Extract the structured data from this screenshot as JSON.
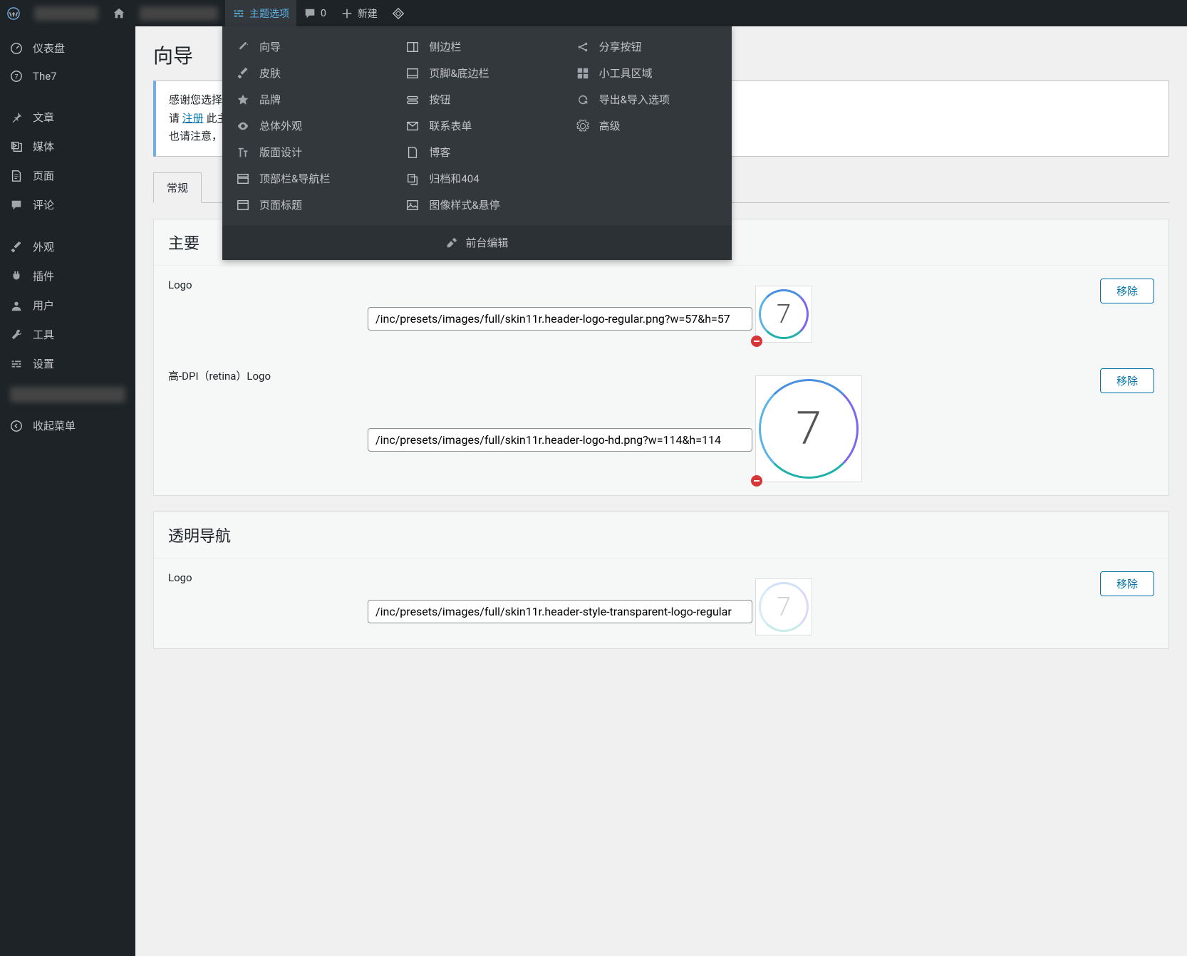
{
  "topbar": {
    "theme_options": "主题选项",
    "comments_count": "0",
    "new": "新建"
  },
  "sidebar": {
    "dashboard": "仪表盘",
    "the7": "The7",
    "posts": "文章",
    "media": "媒体",
    "pages": "页面",
    "comments": "评论",
    "appearance": "外观",
    "plugins": "插件",
    "users": "用户",
    "tools": "工具",
    "settings": "设置",
    "collapse": "收起菜单"
  },
  "dropdown": {
    "col1": {
      "wizard": "向导",
      "skin": "皮肤",
      "brand": "品牌",
      "general": "总体外观",
      "layout": "版面设计",
      "topbar_nav": "顶部栏&导航栏",
      "page_title": "页面标题"
    },
    "col2": {
      "sidebar": "侧边栏",
      "footer": "页脚&底边栏",
      "button": "按钮",
      "contact_form": "联系表单",
      "blog": "博客",
      "archive": "归档和404",
      "image_hover": "图像样式&悬停"
    },
    "col3": {
      "share": "分享按钮",
      "widget": "小工具区域",
      "import_export": "导出&导入选项",
      "advanced": "高级"
    },
    "footer": "前台编辑"
  },
  "page": {
    "title": "向导",
    "notice_line1_prefix": "感谢您选择",
    "notice_line2_prefix": "请 ",
    "notice_register": "注册",
    "notice_line2_suffix": " 此主",
    "notice_line3": "也请注意，",
    "tabs": {
      "general": "常规"
    }
  },
  "panel1": {
    "title": "主要",
    "row1": {
      "label": "Logo",
      "value": "/inc/presets/images/full/skin11r.header-logo-regular.png?w=57&h=57",
      "remove": "移除"
    },
    "row2": {
      "label": "高-DPI（retina）Logo",
      "value": "/inc/presets/images/full/skin11r.header-logo-hd.png?w=114&h=114",
      "remove": "移除"
    }
  },
  "panel2": {
    "title": "透明导航",
    "row1": {
      "label": "Logo",
      "value": "/inc/presets/images/full/skin11r.header-style-transparent-logo-regular",
      "remove": "移除"
    }
  }
}
